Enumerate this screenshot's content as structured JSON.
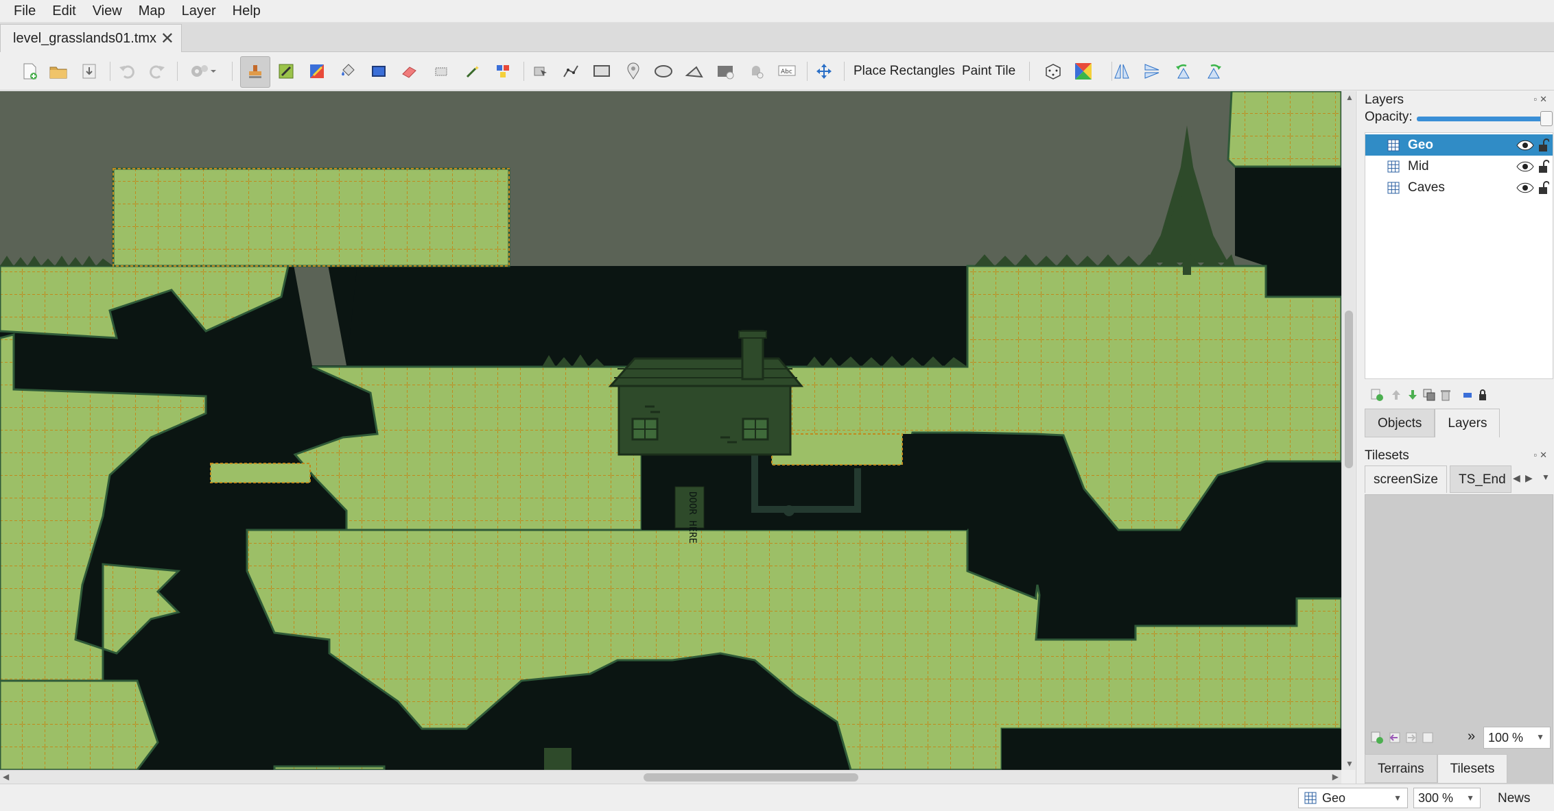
{
  "app": {
    "menu": [
      "File",
      "Edit",
      "View",
      "Map",
      "Layer",
      "Help"
    ],
    "document_tab": "level_grasslands01.tmx",
    "close_glyph": "✕"
  },
  "toolbar": {
    "place_rectangles": "Place Rectangles",
    "paint_tile": "Paint Tile",
    "icons": [
      "new-map-icon",
      "open-icon",
      "save-icon",
      "undo-icon",
      "redo-icon",
      "command-icon",
      "stamp-brush-icon",
      "terrain-brush-icon",
      "wang-brush-icon",
      "bucket-fill-icon",
      "shape-fill-icon",
      "eraser-icon",
      "rect-select-icon",
      "magic-wand-icon",
      "select-same-tile-icon",
      "select-objects-icon",
      "edit-polygons-icon",
      "insert-rectangle-icon",
      "insert-point-icon",
      "insert-ellipse-icon",
      "insert-polygon-icon",
      "insert-tile-icon",
      "insert-template-icon",
      "insert-text-icon",
      "move-icon",
      "random-mode-icon",
      "wang-fill-icon",
      "flip-horizontal-icon",
      "flip-vertical-icon",
      "rotate-left-icon",
      "rotate-right-icon"
    ]
  },
  "layers_panel": {
    "title": "Layers",
    "opacity_label": "Opacity:",
    "opacity": 1.0,
    "layers": [
      {
        "name": "Geo",
        "selected": true,
        "visible": true
      },
      {
        "name": "Mid",
        "selected": false,
        "visible": true
      },
      {
        "name": "Caves",
        "selected": false,
        "visible": true
      }
    ],
    "tabs": [
      "Objects",
      "Layers"
    ],
    "active_tab": "Layers"
  },
  "tilesets_panel": {
    "title": "Tilesets",
    "tabs": [
      "screenSize",
      "TS_End"
    ],
    "zoom": "100 %",
    "bottom_tabs": [
      "Terrains",
      "Tilesets"
    ],
    "active_bottom_tab": "Tilesets",
    "more_glyph": "»"
  },
  "map": {
    "sign_text": "DOOR HERE",
    "colors": {
      "sky": "#5b6356",
      "grass": "#9cbf67",
      "cave": "#0b1512",
      "dark_green": "#2e4a2a",
      "grid": "#c08a1d"
    }
  },
  "statusbar": {
    "current_layer": "Geo",
    "zoom": "300 %",
    "news": "News"
  }
}
